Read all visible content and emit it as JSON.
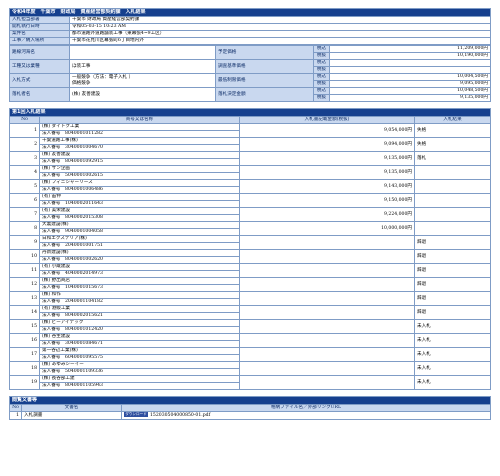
{
  "header": {
    "title": "令和4年度　千葉市　財政局　資産経営部契約課　入札結果"
  },
  "info": [
    {
      "label": "入札担当部署",
      "value": "千葉市 財政局 資産経営部契約課"
    },
    {
      "label": "開札執行日時",
      "value": "令和05-03-15 10:23 AM"
    },
    {
      "label": "案件名",
      "value": "都市道路外道路舗装工事（東幕張4~9工区）"
    },
    {
      "label": "工事／納入場所",
      "value": "千葉市花見川区幕張町6丁目地内外"
    }
  ],
  "details": {
    "koji_label": "路線河海名",
    "koji_value": "",
    "gyoshu_label": "工種又は業種",
    "gyoshu_value": "ほ装工事",
    "hoshiki_label": "入札方式",
    "hoshiki_value1": "一般競争（方法：電子入札 ）",
    "hoshiki_value2": "価格競争",
    "rakusatsu_label": "落札者名",
    "rakusatsu_value": "(株) 友善建設",
    "yotei_label": "予定価格",
    "chosa_label": "調査基準価格",
    "saitei_label": "最低制限価格",
    "kettei_label": "落札決定金額",
    "zeikomi": "税込",
    "zeinuki": "税抜",
    "yotei_in": "11,209,000円",
    "yotei_ex": "10,190,000円",
    "chosa_in": "",
    "chosa_ex": "",
    "saitei_in": "10,004,500円",
    "saitei_ex": "9,095,000円",
    "kettei_in": "10,048,500円",
    "kettei_ex": "9,135,000円"
  },
  "results": {
    "title": "第1回入札結果",
    "columns": [
      "No",
      "商号又は名称",
      "入札書記載金額(税抜)",
      "入札結果"
    ],
    "rows": [
      {
        "no": "1",
        "name": "(株) ダイトク工業",
        "code": "法人番号　8040001011282",
        "amount": "9,054,000円",
        "result": "失格"
      },
      {
        "no": "2",
        "name": "千葉道路工事(株)",
        "code": "法人番号　3040001004670",
        "amount": "9,094,000円",
        "result": "失格"
      },
      {
        "no": "3",
        "name": "(株) 友善建設",
        "code": "法人番号　8040001092915",
        "amount": "9,135,000円",
        "result": "落札"
      },
      {
        "no": "4",
        "name": "(株) サン企画",
        "code": "法人番号　5040001002615",
        "amount": "9,135,000円",
        "result": ""
      },
      {
        "no": "5",
        "name": "(株) フィニシャーリース",
        "code": "法人番号　8040001006486",
        "amount": "9,143,000円",
        "result": ""
      },
      {
        "no": "6",
        "name": "(有) 笛伸",
        "code": "法人番号　1040002011643",
        "amount": "9,150,000円",
        "result": ""
      },
      {
        "no": "7",
        "name": "(有) 美栄建設",
        "code": "法人番号　8040002015308",
        "amount": "9,224,000円",
        "result": ""
      },
      {
        "no": "8",
        "name": "大裏建設(株)",
        "code": "法人番号　9040001004058",
        "amount": "10,000,000円",
        "result": ""
      },
      {
        "no": "9",
        "name": "日和エクステリア(株)",
        "code": "法人番号　2040001001751",
        "amount": "",
        "result": "辞退"
      },
      {
        "no": "10",
        "name": "丹新建設(株)",
        "code": "法人番号　8040001002620",
        "amount": "",
        "result": "辞退"
      },
      {
        "no": "11",
        "name": "(有) 小蔵建設",
        "code": "法人番号　4040002014973",
        "amount": "",
        "result": "辞退"
      },
      {
        "no": "12",
        "name": "(株) 野出商店",
        "code": "法人番号　1040001015673",
        "amount": "",
        "result": "辞退"
      },
      {
        "no": "13",
        "name": "(株) 和作",
        "code": "法人番号　2040001104182",
        "amount": "",
        "result": "辞退"
      },
      {
        "no": "14",
        "name": "(有) 港販工業",
        "code": "法人番号　8040002015621",
        "amount": "",
        "result": "辞退"
      },
      {
        "no": "15",
        "name": "(株) ビーアイテック",
        "code": "法人番号　8040001012420",
        "amount": "",
        "result": "未入札"
      },
      {
        "no": "16",
        "name": "(株) 谷生建設",
        "code": "法人番号　3040001084671",
        "amount": "",
        "result": "未入札"
      },
      {
        "no": "17",
        "name": "第一谷辺工業(株)",
        "code": "法人番号　6040001095575",
        "amount": "",
        "result": "未入札"
      },
      {
        "no": "18",
        "name": "(株) あゆみシーイー",
        "code": "法人番号　5040001109336",
        "amount": "",
        "result": "未入札"
      },
      {
        "no": "19",
        "name": "(株) 長谷部工建",
        "code": "法人番号　8040001105943",
        "amount": "",
        "result": "未入札"
      }
    ]
  },
  "attachments": {
    "title": "閲覧文書等",
    "columns": [
      "No",
      "文書名",
      "格納ファイル名／外部リンクURL"
    ],
    "rows": [
      {
        "no": "1",
        "name": "入札調書",
        "button": "ダウンロード",
        "file": "152030504000850-01.pdf"
      }
    ]
  }
}
